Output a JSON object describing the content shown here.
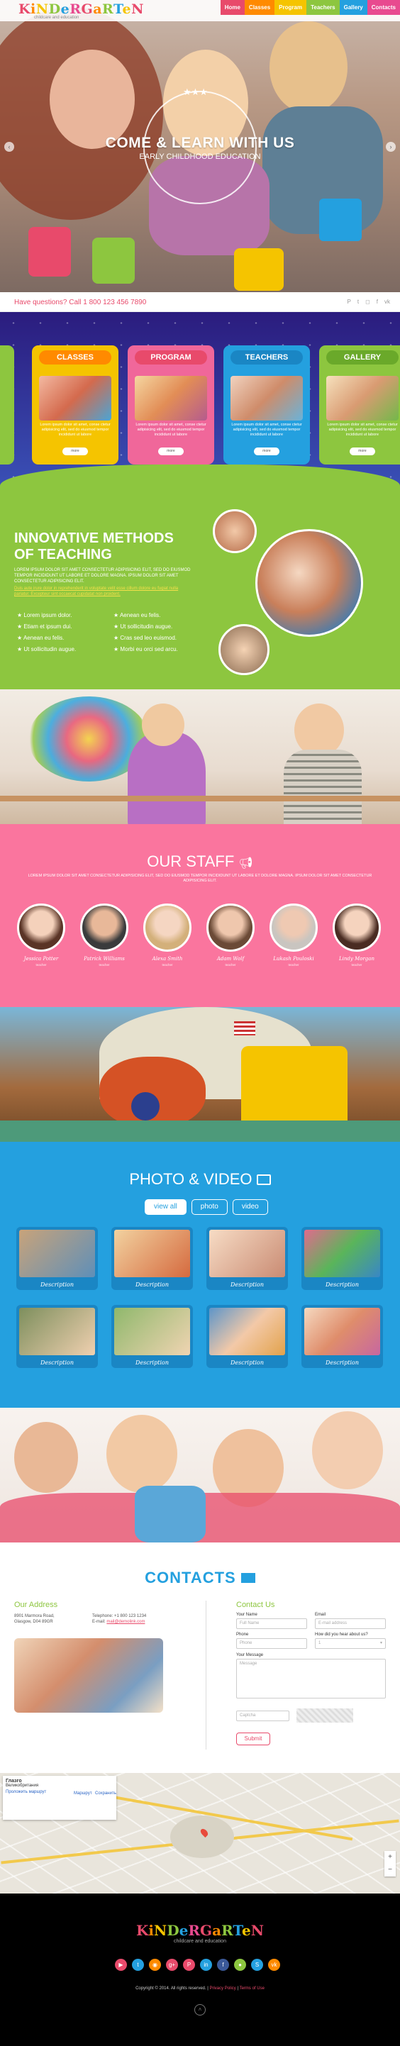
{
  "header": {
    "logo": "KiNDeRGaRTeN",
    "logo_sub": "childcare and education",
    "nav": [
      {
        "label": "Home",
        "color": "#e84a6b"
      },
      {
        "label": "Classes",
        "color": "#ff8a00"
      },
      {
        "label": "Program",
        "color": "#f5c400"
      },
      {
        "label": "Teachers",
        "color": "#8dc63f"
      },
      {
        "label": "Gallery",
        "color": "#24a0df"
      },
      {
        "label": "Contacts",
        "color": "#e84a8f"
      }
    ]
  },
  "hero": {
    "title": "COME & LEARN WITH US",
    "subtitle": "EARLY CHILDHOOD EDUCATION"
  },
  "question_bar": {
    "text": "Have questions? Call 1 800 123 456 7890",
    "icons": [
      "pinterest-icon",
      "twitter-icon",
      "instagram-icon",
      "facebook-icon",
      "vk-icon"
    ]
  },
  "classes": {
    "cards": [
      {
        "title": "CLASSES",
        "color": "#f5c400",
        "title_color": "#ff8a00",
        "text": "Lorem ipsum dolor sit amet, conse ctetur adipisicing elit, sed do eiusmod tempor incididunt ut labore",
        "button": "more"
      },
      {
        "title": "PROGRAM",
        "color": "#f0679a",
        "title_color": "#e84a6b",
        "text": "Lorem ipsum dolor sit amet, conse ctetur adipisicing elit, sed do eiusmod tempor incididunt ut labore",
        "button": "more"
      },
      {
        "title": "TEACHERS",
        "color": "#24a0df",
        "title_color": "#1a86c4",
        "text": "Lorem ipsum dolor sit amet, conse ctetur adipisicing elit, sed do eiusmod tempor incididunt ut labore",
        "button": "more"
      },
      {
        "title": "GALLERY",
        "color": "#8dc63f",
        "title_color": "#6aa92a",
        "text": "Lorem ipsum dolor sit amet, conse ctetur adipisicing elit, sed do eiusmod tempor incididunt ut labore",
        "button": "more"
      }
    ]
  },
  "innovative": {
    "title_line1": "INNOVATIVE METHODS",
    "title_line2": "OF TEACHING",
    "text": "LOREM IPSUM DOLOR SIT AMET CONSECTETUR ADIPISICING ELIT, SED DO EIUSMOD TEMPOR INCIDIDUNT UT LABORE ET DOLORE MAGNA. IPSUM DOLOR SIT AMET CONSECTETUR ADIPISICING ELIT.",
    "link_text": "Duis aute irure dolor in reprehenderit in voluptate velit esse cillum dolore eu fugiat nulla pariatur. Excepteur sint occaecat cupidatat non proident.",
    "list_left": [
      "Lorem ipsum dolor.",
      "Etiam et ipsum dui.",
      "Aenean eu felis.",
      "Ut sollicitudin augue."
    ],
    "list_right": [
      "Aenean eu felis.",
      "Ut sollicitudin augue.",
      "Cras sed leo euismod.",
      "Morbi eu orci sed arcu."
    ]
  },
  "staff": {
    "title": "OUR STAFF",
    "text": "LOREM IPSUM DOLOR SIT AMET CONSECTETUR ADIPISICING ELIT, SED DO EIUSMOD TEMPOR INCIDIDUNT UT LABORE ET DOLORE MAGNA. IPSUM DOLOR SIT AMET CONSECTETUR ADIPISICING ELIT.",
    "members": [
      {
        "name": "Jessica Potter",
        "role": "teacher"
      },
      {
        "name": "Patrick Williams",
        "role": "teacher"
      },
      {
        "name": "Alexa Smith",
        "role": "teacher"
      },
      {
        "name": "Adam Wolf",
        "role": "teacher"
      },
      {
        "name": "Lukash Pouloski",
        "role": "teacher"
      },
      {
        "name": "Lindy Morgan",
        "role": "teacher"
      }
    ]
  },
  "gallery": {
    "title": "PHOTO & VIDEO",
    "filters": [
      "view all",
      "photo",
      "video"
    ],
    "items": [
      "Description",
      "Description",
      "Description",
      "Description",
      "Description",
      "Description",
      "Description",
      "Description"
    ]
  },
  "contacts": {
    "title": "CONTACTS",
    "address_heading": "Our Address",
    "address_lines": [
      "8901 Marmora Road,",
      "Glasgow, D04 89GR"
    ],
    "phone": "Telephone: +1 800 123 1234",
    "email_label": "E-mail:",
    "email": "mail@demolink.com",
    "form_heading": "Contact Us",
    "form": {
      "name_label": "Your Name",
      "name_placeholder": "Full Name",
      "email_label": "Email",
      "email_placeholder": "E-mail address",
      "phone_label": "Phone",
      "phone_placeholder": "Phone",
      "how_label": "How did you hear about us?",
      "how_value": "1",
      "message_label": "Your Message",
      "message_placeholder": "Message",
      "captcha_placeholder": "Captcha",
      "submit": "Submit"
    }
  },
  "map": {
    "place": "Глазго",
    "place_sub": "Великобритания",
    "route_link": "Проложить маршрут",
    "route_btn": "Маршрут",
    "save_btn": "Сохранить"
  },
  "footer": {
    "logo": "KiNDeRGaRTeN",
    "logo_sub": "childcare and education",
    "social": [
      {
        "icon": "youtube-icon",
        "color": "#e84a6b"
      },
      {
        "icon": "twitter-icon",
        "color": "#24a0df"
      },
      {
        "icon": "rss-icon",
        "color": "#ff8a00"
      },
      {
        "icon": "google-plus-icon",
        "color": "#e84a6b"
      },
      {
        "icon": "pinterest-icon",
        "color": "#e84a6b"
      },
      {
        "icon": "linkedin-icon",
        "color": "#24a0df"
      },
      {
        "icon": "facebook-icon",
        "color": "#3b5998"
      },
      {
        "icon": "flickr-icon",
        "color": "#8dc63f"
      },
      {
        "icon": "skype-icon",
        "color": "#24a0df"
      },
      {
        "icon": "vk-icon",
        "color": "#ff8a00"
      }
    ],
    "copyright": "Copyright © 2014. All rights reserved.",
    "privacy": "Privacy Policy",
    "terms": "Terms of Use"
  }
}
